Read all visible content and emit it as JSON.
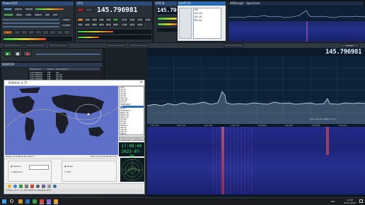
{
  "main_freq": "145.796981",
  "sub_freq": "145.796981",
  "spectrum_freq": "145.796981",
  "orbitron": {
    "title": "Orbitron 3.71",
    "clock_time": "17:08:40",
    "clock_date": "2023-07-30",
    "status_bar": "Orbitron 3.71 - (c) 2001-2005 by Sebastian Stoff",
    "map_footer_left": "Rostov 47.2380 N 39.7220 E",
    "map_footer_right": "2023-07-30 14:08:40 (UTC)",
    "satellites": [
      "AO-7",
      "AO-27",
      "AO-73",
      "AO-91",
      "AO-92",
      "CAS-4A",
      "CAS-4B",
      "FO-29",
      "FUNCUBE-1",
      "ISS",
      "JO-97",
      "LILACSAT-2",
      "NOAA 15",
      "NOAA 18",
      "NOAA 19",
      "PO-101",
      "RS-44",
      "SO-50",
      "TEVEL-1",
      "XW-2A",
      "XW-2B",
      "XW-2C",
      "ZARYA"
    ],
    "selected_satellite": "ISS",
    "tracking_label": "Tracking",
    "settings_label": "Settings",
    "radio1": "Сейчас",
    "radio2": "Прогноз",
    "radio3": "Фазы",
    "radio4": "UTC",
    "tab_rotor": "Rotor/Radio",
    "tab_start": "Start",
    "btn_start": "Старт"
  },
  "radio_panel": {
    "tabs": [
      "MODE",
      "VFO A",
      "VFO B"
    ],
    "mode_buttons": [
      "LSB",
      "USB",
      "DSB",
      "CWL",
      "CWU",
      "FM",
      "AM",
      "SAM",
      "SPEC",
      "DIGL",
      "DIGU",
      "DRM"
    ],
    "filter_buttons": [
      "2.7k",
      "2.4k",
      "2.1k",
      "1.8k",
      "1.0k",
      "Var1",
      "Var2"
    ],
    "power_buttons": [
      "POWER",
      "MOX",
      "TUN",
      "SPLIT",
      "RIT",
      "XIT"
    ],
    "memory_header": [
      "Frequency",
      "Mode",
      "Description"
    ],
    "memory_rows": [
      [
        "145.800000",
        "FM",
        "ISS"
      ],
      [
        "145.990000",
        "FM",
        "SO-50"
      ],
      [
        "436.795000",
        "FM",
        "AO-91"
      ],
      [
        "145.935000",
        "FM",
        "RS-44"
      ]
    ],
    "memory_title": "MEMORY",
    "band_label": "2m",
    "agc_label": "AGC",
    "step_label": "1 kHz"
  },
  "spectrum_window": {
    "title": "SDRangel - Spectrum",
    "freq_axis": [
      "145.700",
      "145.725",
      "145.750",
      "145.775",
      "145.800",
      "145.825",
      "145.850",
      "145.875"
    ],
    "db_axis": [
      "-20",
      "-40",
      "-60",
      "-80",
      "-100",
      "-120"
    ],
    "info_line": "Span 96 kHz RBW 24 Hz",
    "zoom_label": "ZOOM"
  },
  "top_small_window": {
    "title": "SatPC32",
    "items": [
      "ISS",
      "SO-50",
      "AO-91",
      "RS-44"
    ]
  },
  "taskbar": {
    "time": "17:08",
    "date": "30.07.2023",
    "lang": "РУС"
  }
}
